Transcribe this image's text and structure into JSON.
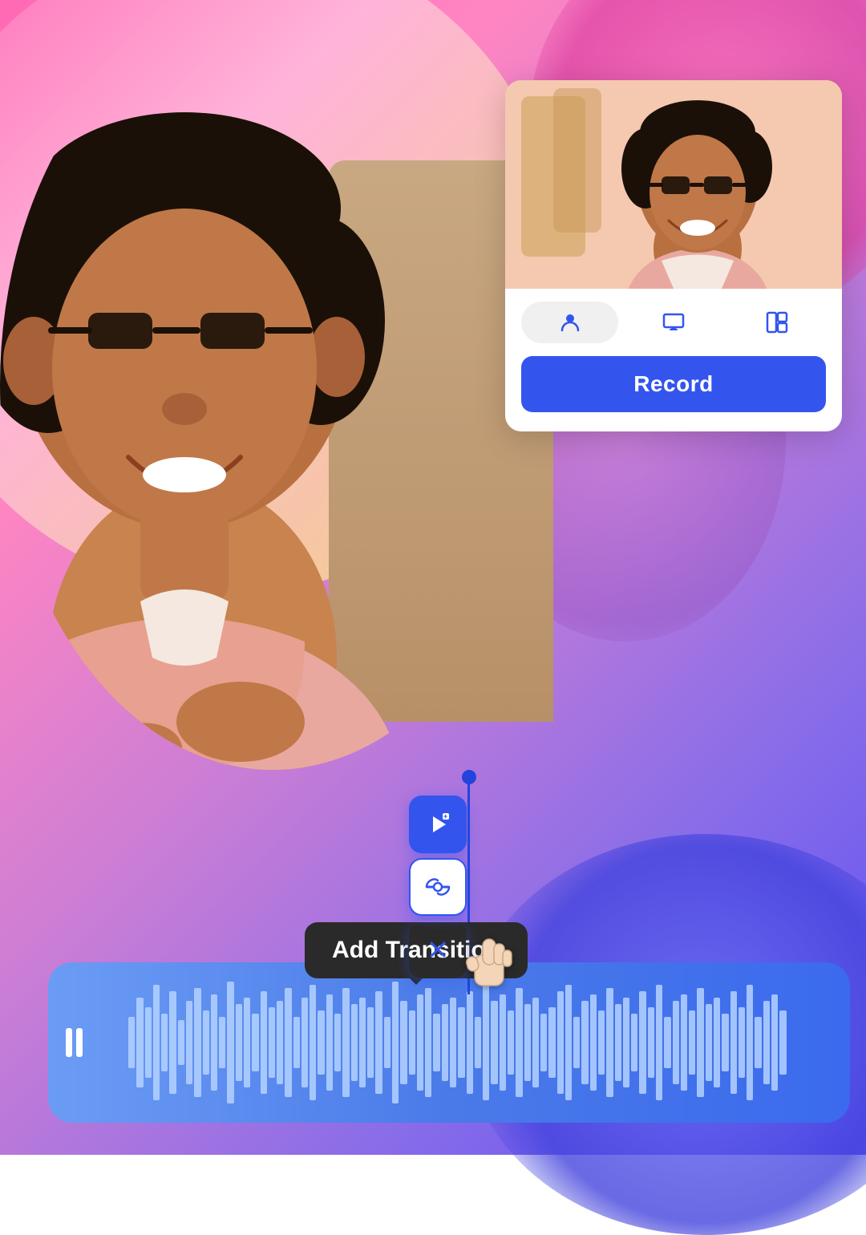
{
  "background": {
    "gradient_start": "#ff69b4",
    "gradient_end": "#5b4ef5"
  },
  "record_card": {
    "title": "Record",
    "record_button_label": "Record",
    "mode_buttons": [
      {
        "id": "person",
        "icon": "person-icon",
        "active": true
      },
      {
        "id": "screen",
        "icon": "screen-icon",
        "active": false
      },
      {
        "id": "layout",
        "icon": "layout-icon",
        "active": false
      }
    ]
  },
  "tooltip": {
    "text": "Add Transition"
  },
  "context_menu": {
    "items": [
      {
        "id": "add-clip",
        "icon": "add-clip-icon"
      },
      {
        "id": "transition",
        "icon": "transition-icon"
      }
    ],
    "close_icon": "close-icon"
  },
  "timeline": {
    "waveform_bars": 80,
    "playhead_position": "54%"
  }
}
